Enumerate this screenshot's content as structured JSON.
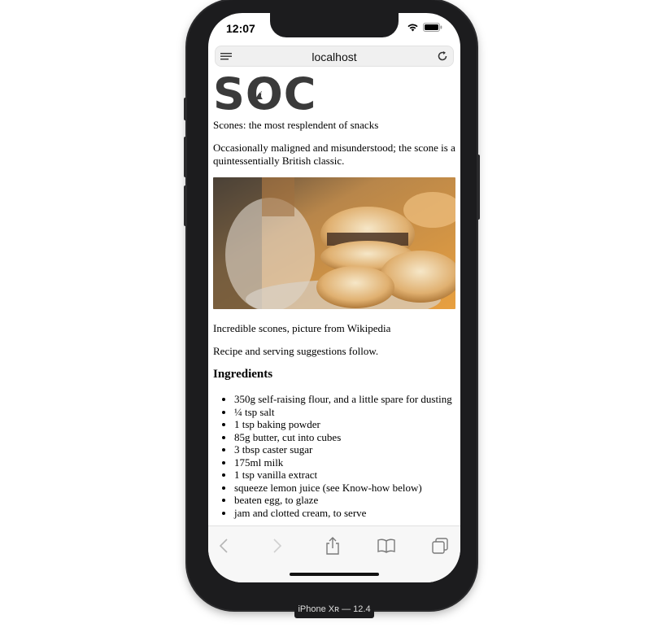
{
  "status_bar": {
    "time": "12:07"
  },
  "browser": {
    "url": "localhost",
    "menu_icon": "reader-menu-icon",
    "reload_icon": "reload-icon"
  },
  "page": {
    "logo": "SOC",
    "tagline": "Scones: the most resplendent of snacks",
    "intro": "Occasionally maligned and misunderstood; the scone is a quintessentially British classic.",
    "image_caption": "Incredible scones, picture from Wikipedia",
    "follow_text": "Recipe and serving suggestions follow.",
    "ingredients_heading": "Ingredients",
    "ingredients": [
      "350g self-raising flour, and a little spare for dusting",
      "¼ tsp salt",
      "1 tsp baking powder",
      "85g butter, cut into cubes",
      "3 tbsp caster sugar",
      "175ml milk",
      "1 tsp vanilla extract",
      "squeeze lemon juice (see Know-how below)",
      "beaten egg, to glaze",
      "jam and clotted cream, to serve"
    ]
  },
  "toolbar": {
    "back_icon": "back-chevron-icon",
    "forward_icon": "forward-chevron-icon",
    "share_icon": "share-icon",
    "bookmarks_icon": "bookmarks-icon",
    "tabs_icon": "tabs-icon"
  },
  "device_label": "iPhone Xʀ — 12.4",
  "colors": {
    "frame": "#1c1c1e",
    "image_orange": "#e8a040",
    "text": "#000000"
  }
}
